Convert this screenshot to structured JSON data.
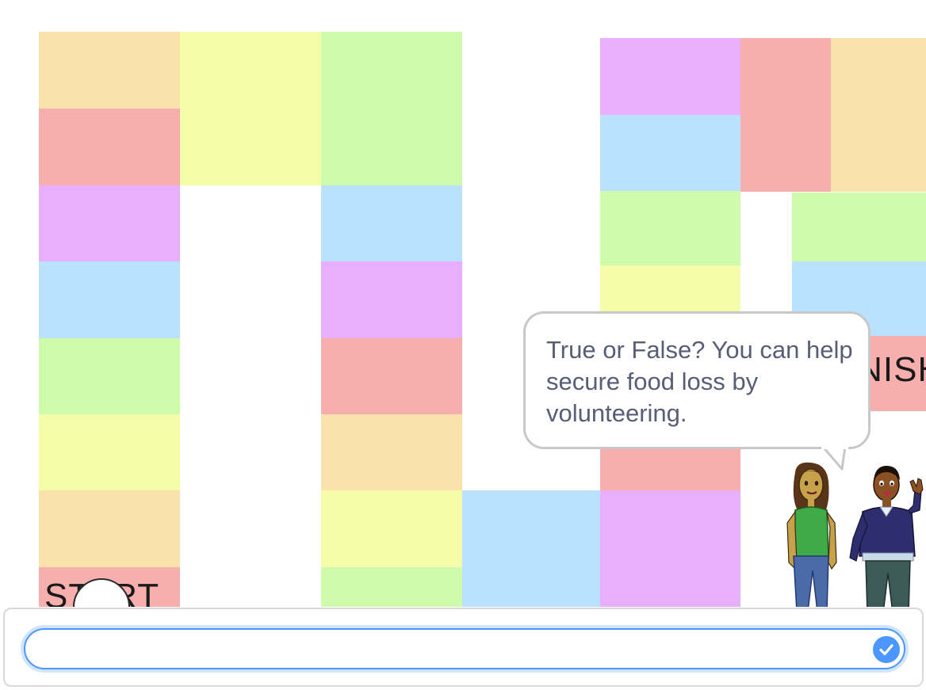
{
  "board": {
    "start_label": "START",
    "finish_label": "FINISH",
    "colors": {
      "orange": "#f9e2ac",
      "red": "#f7afae",
      "purple": "#e8b0fc",
      "blue": "#bae1fe",
      "green": "#cefcab",
      "yellow": "#f5fdab"
    }
  },
  "question": {
    "text": "True or False? You can help secure food loss by volunteering."
  },
  "characters": [
    "girl-character",
    "boy-character"
  ],
  "answer": {
    "value": "",
    "placeholder": "",
    "submit_icon": "check-icon",
    "accent_color": "#4c97ff"
  }
}
